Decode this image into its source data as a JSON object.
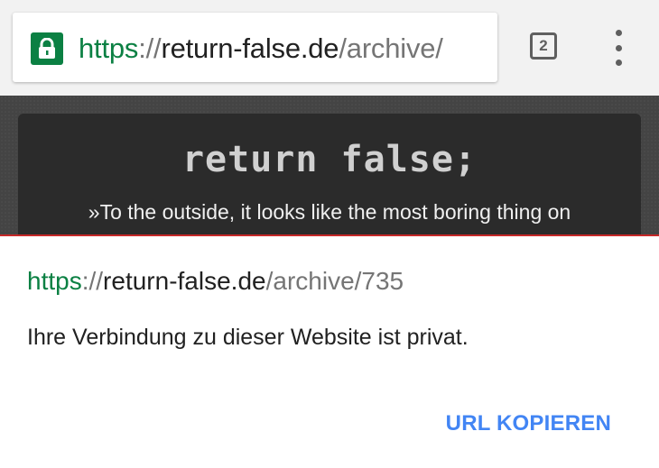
{
  "browser": {
    "url": {
      "scheme": "https",
      "separator": "://",
      "host": "return-false.de",
      "path": "/archive/"
    },
    "tab_count": "2",
    "lock_color": "#0b8043"
  },
  "page": {
    "site_title": "return false;",
    "tagline": "»To the outside, it looks like the most boring thing on"
  },
  "sheet": {
    "url": {
      "scheme": "https",
      "separator": "://",
      "host": "return-false.de",
      "path": "/archive/735"
    },
    "message": "Ihre Verbindung zu dieser Website ist privat.",
    "copy_button": "URL KOPIEREN",
    "accent_color": "#4285f4",
    "warning_line_color": "#c62828"
  }
}
